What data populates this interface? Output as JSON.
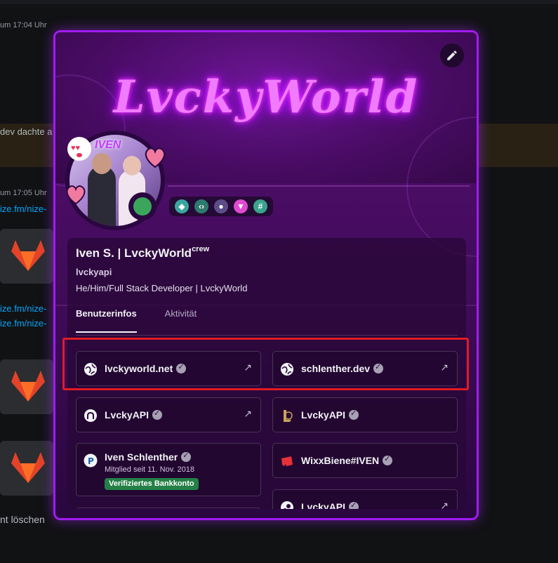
{
  "background": {
    "timestamp_1": "um 17:04 Uhr",
    "snippet_1": "dev dachte a",
    "timestamp_2": "um 17:05 Uhr",
    "link_1": "ize.fm/nize-",
    "link_2": "ize.fm/nize-",
    "link_3": "ize.fm/nize-",
    "footer_text": "nt löschen"
  },
  "profile": {
    "banner_text": "LvckyWorld",
    "avatar_tag": "IVEN",
    "display_name": "Iven S. | LvckyWorld",
    "name_suffix": "crew",
    "username": "lvckyapi",
    "pronouns": "He/Him/Full Stack Developer | LvckyWorld",
    "status_color": "#3ba55c",
    "accent_color": "#a01cf0"
  },
  "tabs": [
    {
      "label": "Benutzerinfos",
      "active": true
    },
    {
      "label": "Aktivität",
      "active": false
    }
  ],
  "connections": [
    {
      "label": "lvckyworld.net",
      "icon": "globe-icon"
    },
    {
      "label": "schlenther.dev",
      "icon": "globe-icon"
    },
    {
      "label": "LvckyAPI",
      "icon": "github-icon"
    },
    {
      "label": "LvckyAPI",
      "icon": "league-of-legends-icon"
    },
    {
      "label": "Iven Schlenther",
      "icon": "paypal-icon",
      "sub": "Mitglied seit 11. Nov. 2018",
      "pill": "Verifiziertes Bankkonto"
    },
    {
      "label": "WixxBiene#IVEN",
      "icon": "riot-games-icon"
    },
    {
      "label": "LvckyAPI",
      "icon": "steam-icon"
    }
  ],
  "arrow_glyph": "↗",
  "badge_text": "#"
}
